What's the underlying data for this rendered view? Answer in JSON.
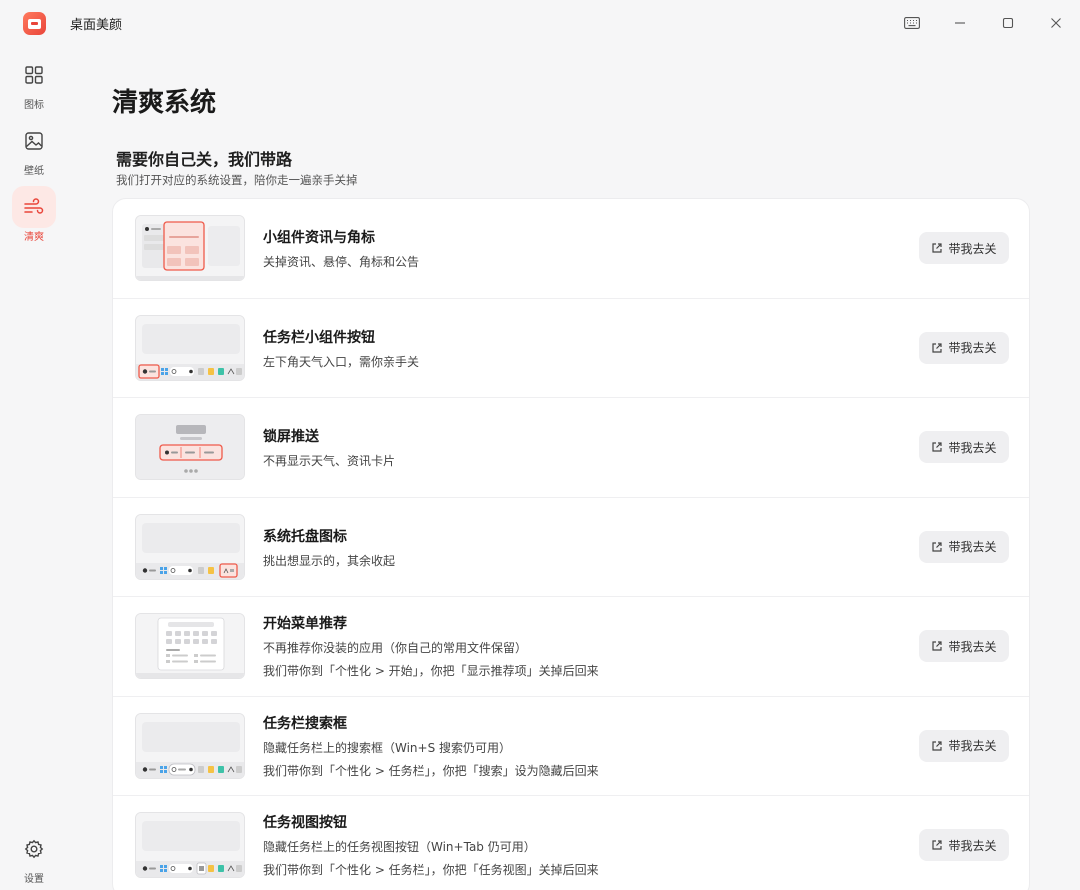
{
  "app": {
    "title": "桌面美颜"
  },
  "sidebar": {
    "items": [
      {
        "label": "图标",
        "icon": "grid-icon"
      },
      {
        "label": "壁纸",
        "icon": "image-icon"
      },
      {
        "label": "清爽",
        "icon": "wind-icon"
      }
    ],
    "settings_label": "设置"
  },
  "main": {
    "title": "清爽系统",
    "section_title": "需要你自己关，我们带路",
    "section_sub": "我们打开对应的系统设置，陪你走一遍亲手关掉",
    "rows": [
      {
        "title": "小组件资讯与角标",
        "desc": "关掉资讯、悬停、角标和公告",
        "note": "",
        "button": "带我去关"
      },
      {
        "title": "任务栏小组件按钮",
        "desc": "左下角天气入口，需你亲手关",
        "note": "",
        "button": "带我去关"
      },
      {
        "title": "锁屏推送",
        "desc": "不再显示天气、资讯卡片",
        "note": "",
        "button": "带我去关"
      },
      {
        "title": "系统托盘图标",
        "desc": "挑出想显示的，其余收起",
        "note": "",
        "button": "带我去关"
      },
      {
        "title": "开始菜单推荐",
        "desc": "不再推荐你没装的应用（你自己的常用文件保留）",
        "note": "我们带你到「个性化 > 开始」，你把「显示推荐项」关掉后回来",
        "button": "带我去关"
      },
      {
        "title": "任务栏搜索框",
        "desc": "隐藏任务栏上的搜索框（Win+S 搜索仍可用）",
        "note": "我们带你到「个性化 > 任务栏」，你把「搜索」设为隐藏后回来",
        "button": "带我去关"
      },
      {
        "title": "任务视图按钮",
        "desc": "隐藏任务栏上的任务视图按钮（Win+Tab 仍可用）",
        "note": "我们带你到「个性化 > 任务栏」，你把「任务视图」关掉后回来",
        "button": "带我去关"
      }
    ]
  },
  "colors": {
    "accent": "#e9453a",
    "accent_bg": "#fde8e5"
  }
}
